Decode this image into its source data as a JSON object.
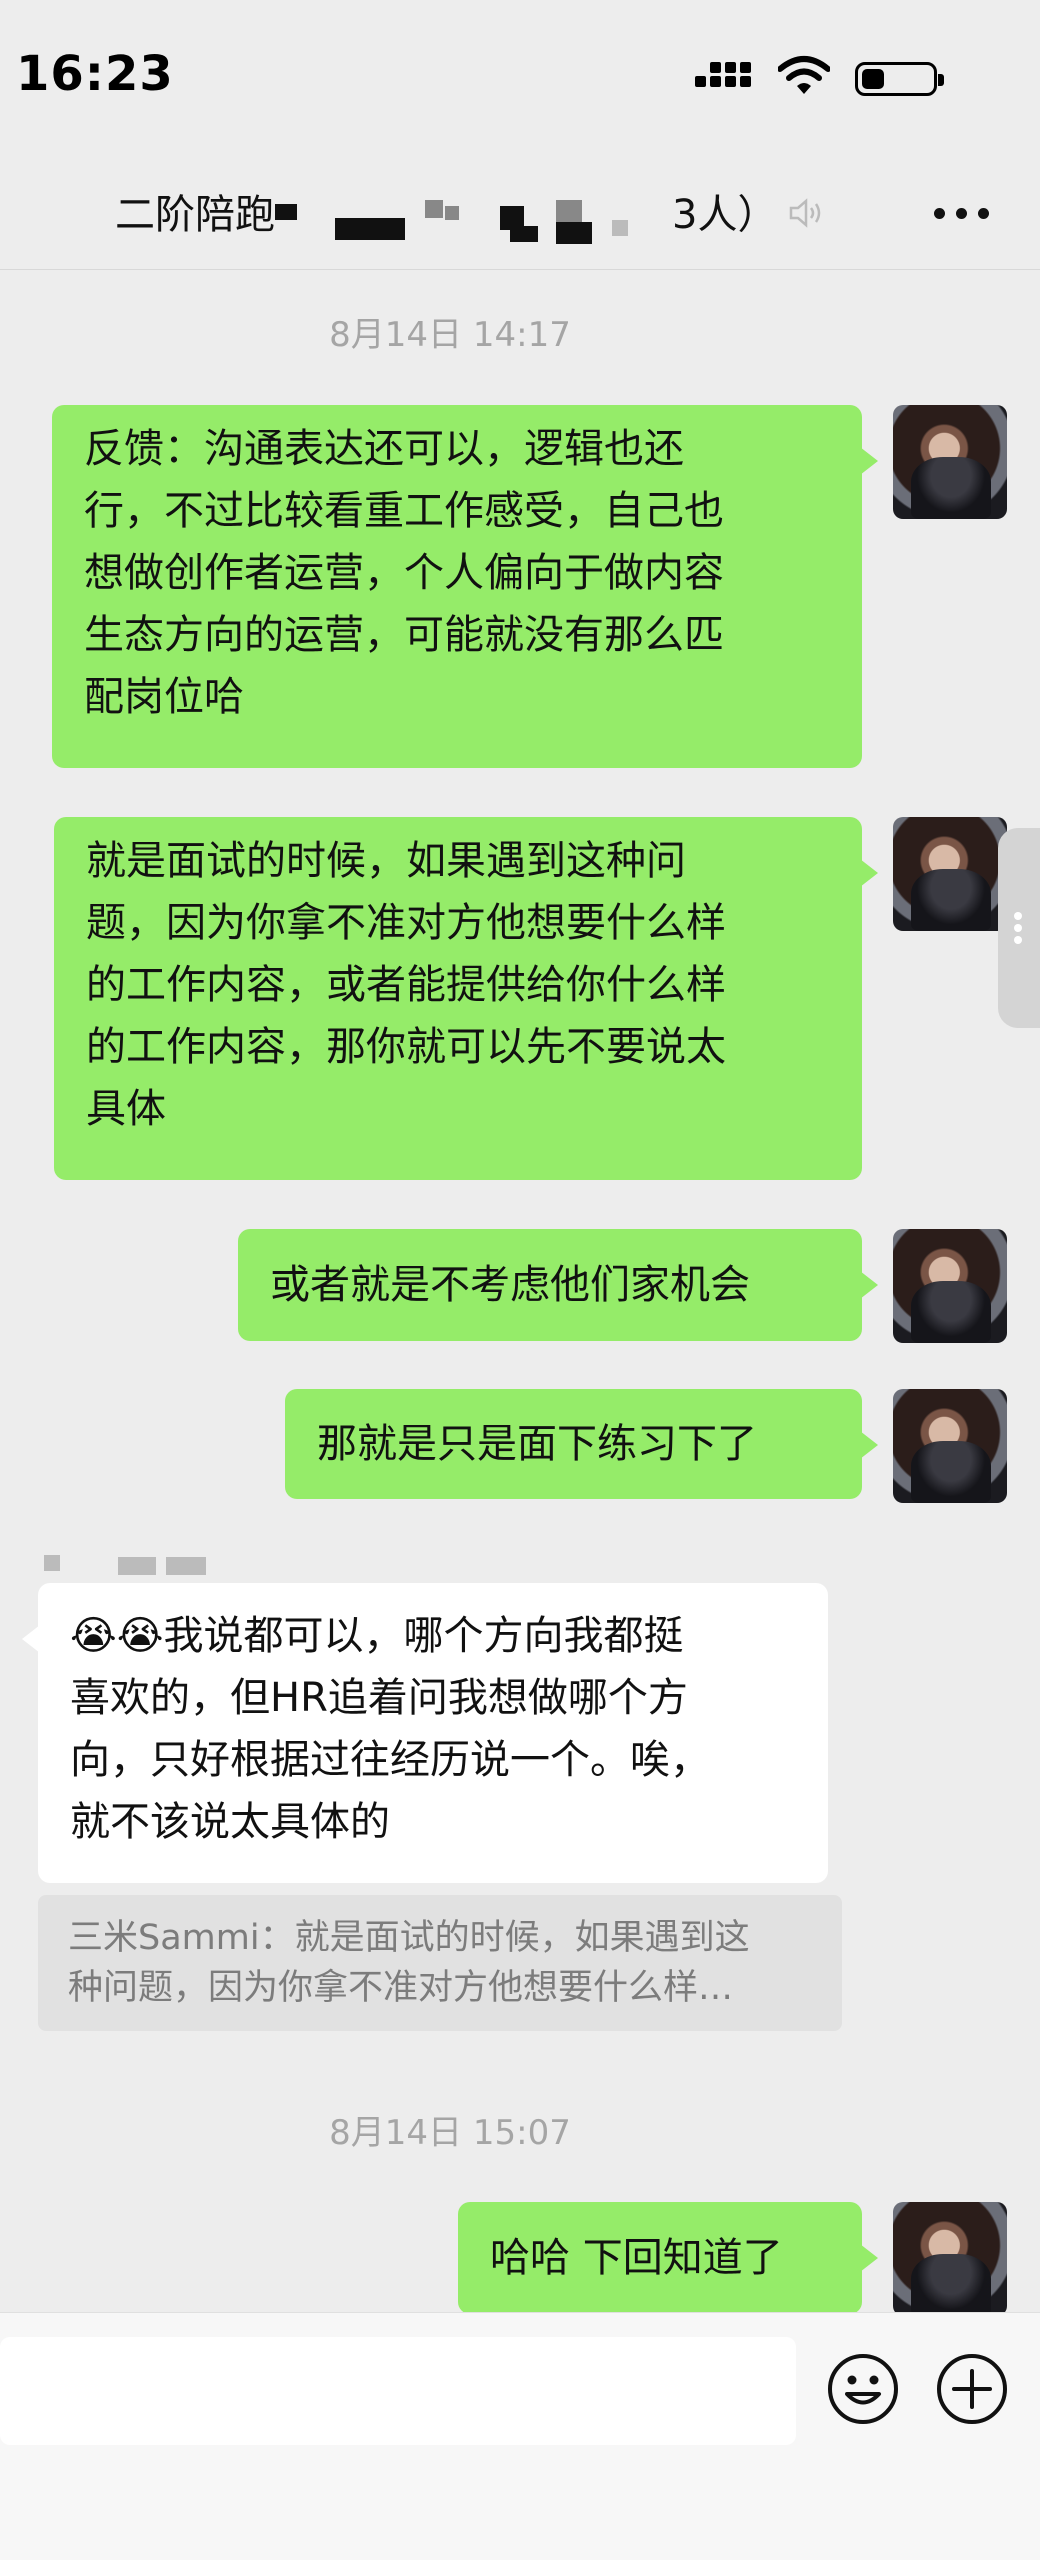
{
  "status": {
    "time": "16:23"
  },
  "nav": {
    "title": "二阶陪跑",
    "member_count": "3人）"
  },
  "timestamps": [
    "8月14日 14:17",
    "8月14日 15:07"
  ],
  "messages": [
    {
      "side": "right",
      "text": "反馈：沟通表达还可以，逻辑也还\n行，不过比较看重工作感受，自己也\n想做创作者运营，个人偏向于做内容\n生态方向的运营，可能就没有那么匹\n配岗位哈"
    },
    {
      "side": "right",
      "text": "就是面试的时候，如果遇到这种问\n题，因为你拿不准对方他想要什么样\n的工作内容，或者能提供给你什么样\n的工作内容，那你就可以先不要说太\n具体"
    },
    {
      "side": "right",
      "text": "或者就是不考虑他们家机会"
    },
    {
      "side": "right",
      "text": "那就是只是面下练习下了"
    },
    {
      "side": "left",
      "text": "😭😭我说都可以，哪个方向我都挺\n喜欢的，但HR追着问我想做哪个方\n向，只好根据过往经历说一个。唉，\n就不该说太具体的"
    },
    {
      "side": "right",
      "text": "哈哈 下回知道了"
    }
  ],
  "quote": {
    "text": "三米Sammi：就是面试的时候，如果遇到这\n种问题，因为你拿不准对方他想要什么样…"
  },
  "input": {
    "value": ""
  },
  "icons": {
    "signal": "signal-icon",
    "wifi": "wifi-icon",
    "battery": "battery-icon",
    "mute": "mute-icon",
    "more": "more-icon",
    "emoji": "emoji-icon",
    "plus": "plus-icon"
  }
}
